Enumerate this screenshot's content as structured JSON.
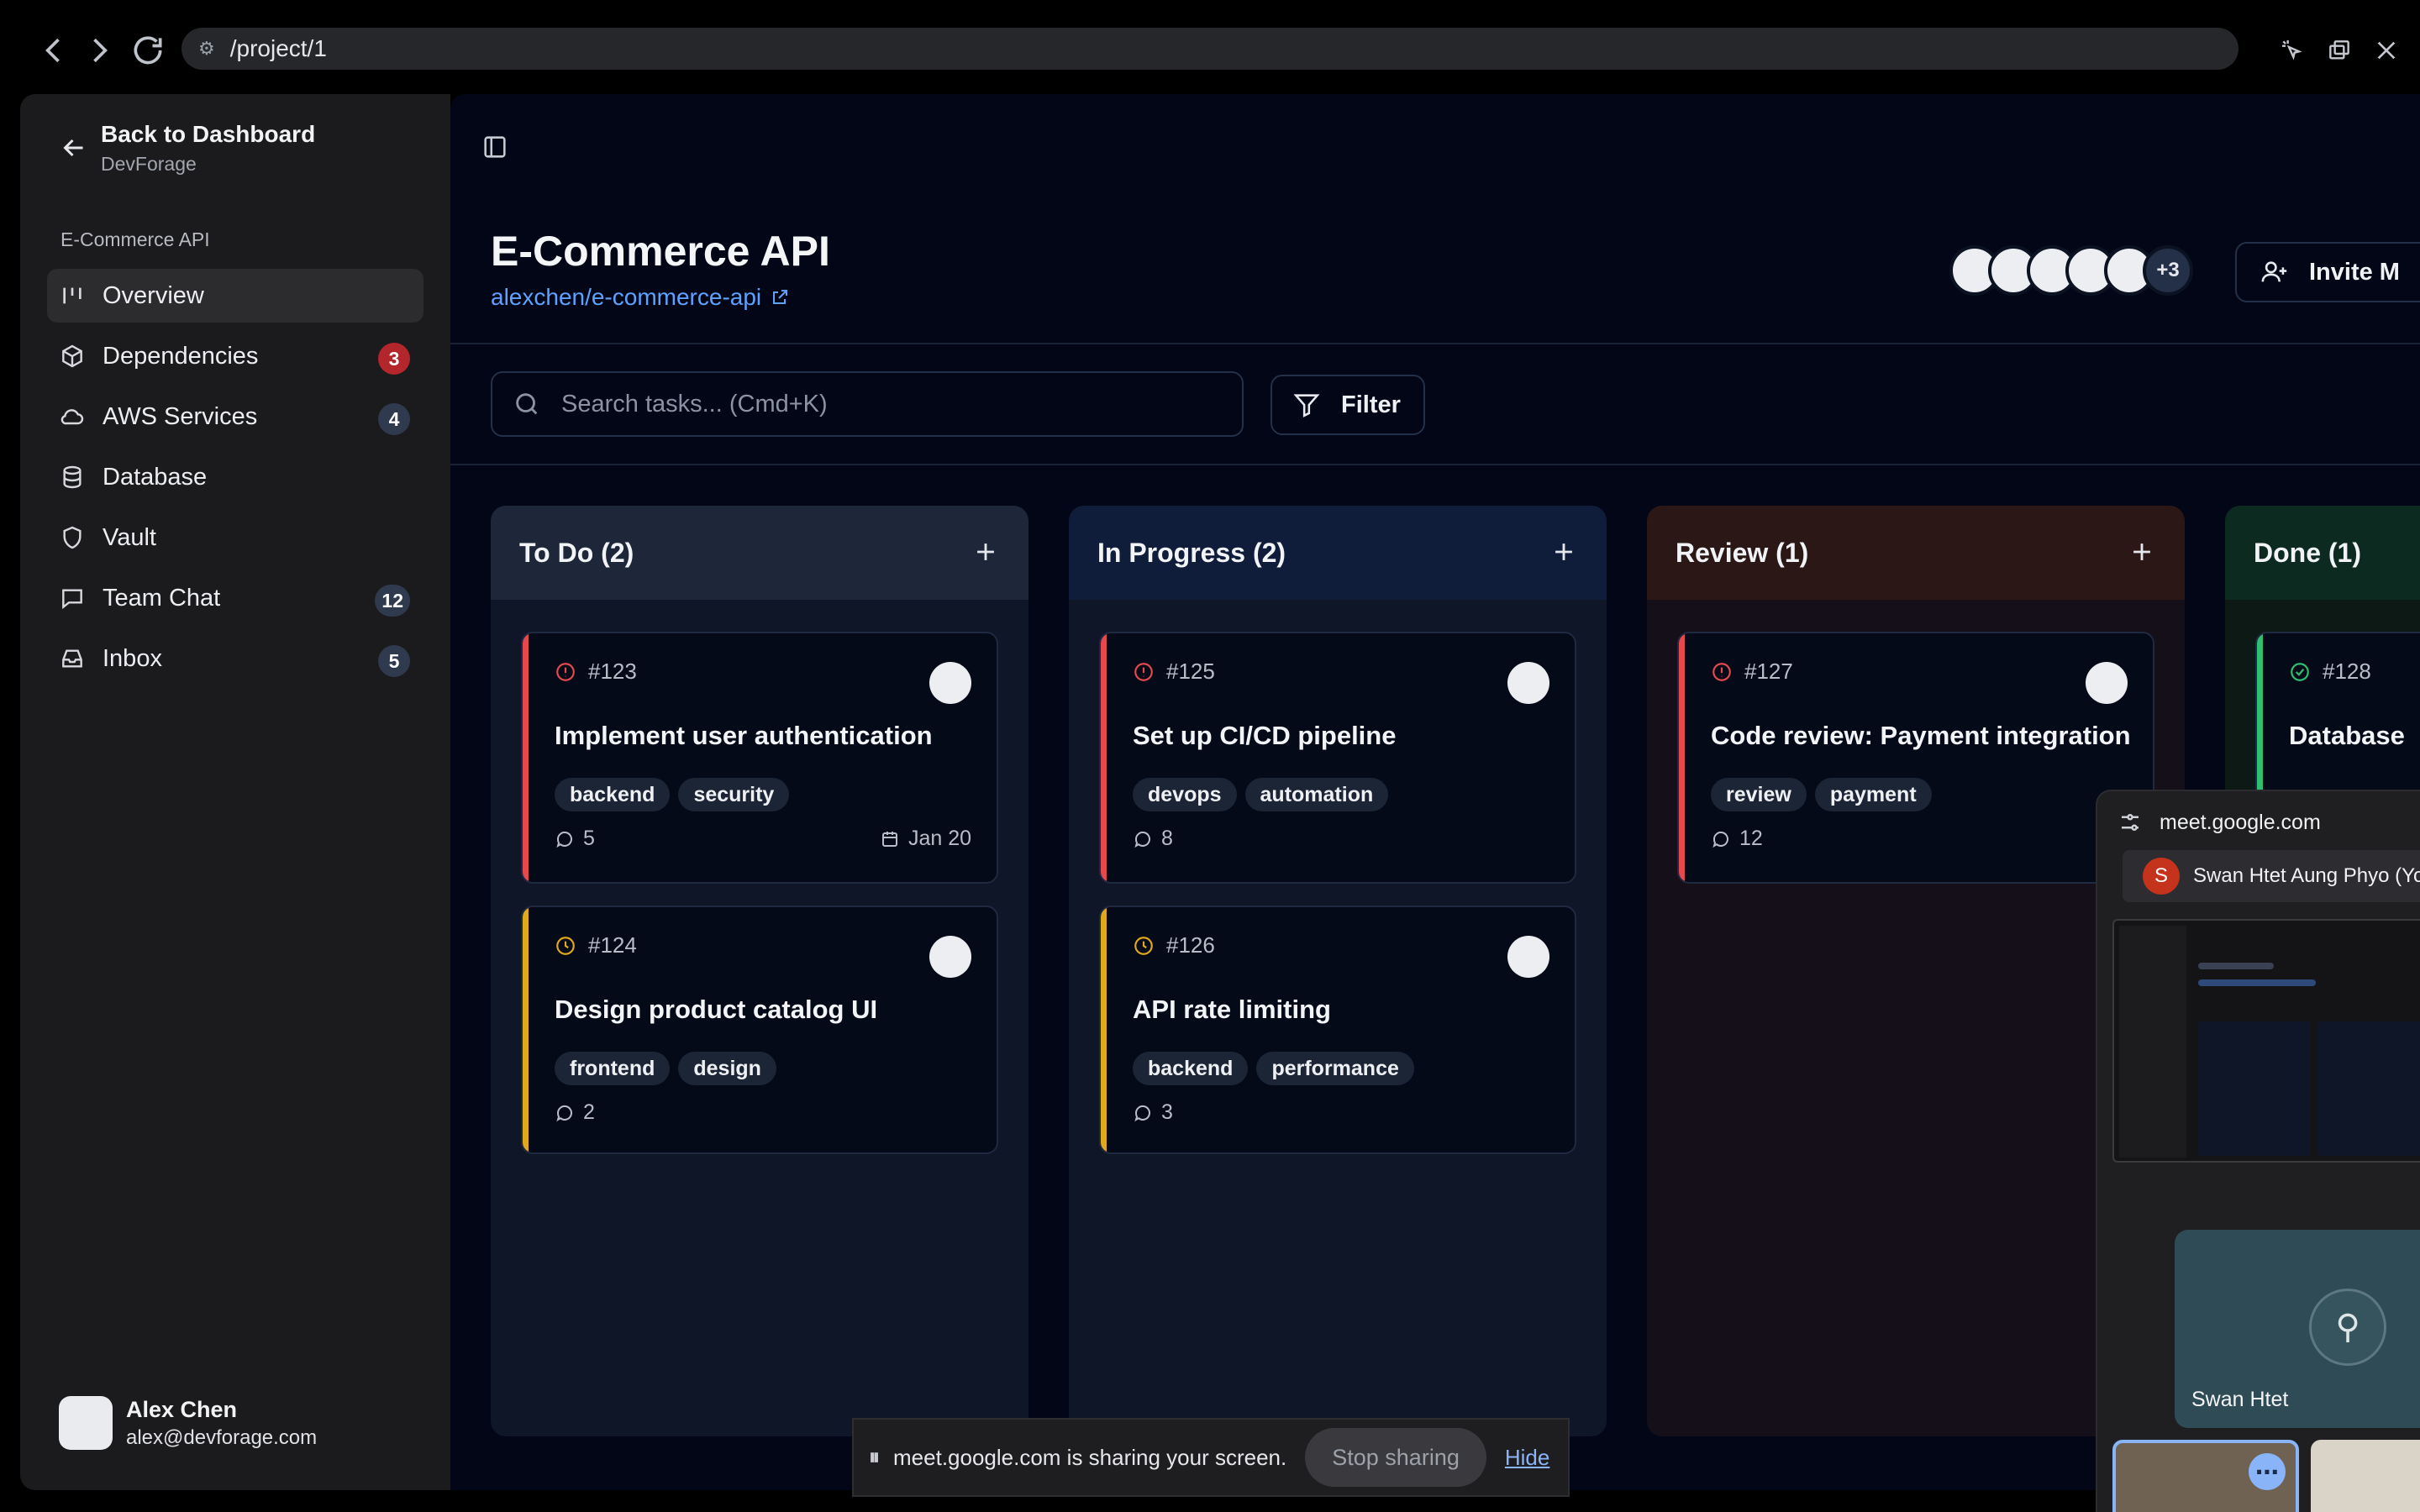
{
  "browser": {
    "url": "/project/1",
    "site_icon": "tune-icon"
  },
  "sidebar": {
    "back_label": "Back to Dashboard",
    "back_sub": "DevForage",
    "project_label": "E-Commerce API",
    "items": [
      {
        "label": "Overview",
        "icon": "kanban-icon",
        "badge": ""
      },
      {
        "label": "Dependencies",
        "icon": "package-icon",
        "badge": "3"
      },
      {
        "label": "AWS Services",
        "icon": "cloud-icon",
        "badge": "4"
      },
      {
        "label": "Database",
        "icon": "database-icon",
        "badge": ""
      },
      {
        "label": "Vault",
        "icon": "shield-icon",
        "badge": ""
      },
      {
        "label": "Team Chat",
        "icon": "chat-icon",
        "badge": "12"
      },
      {
        "label": "Inbox",
        "icon": "inbox-icon",
        "badge": "5"
      }
    ],
    "user": {
      "name": "Alex Chen",
      "email": "alex@devforage.com"
    }
  },
  "header": {
    "title": "E-Commerce API",
    "repo": "alexchen/e-commerce-api",
    "more_members": "+3",
    "invite_label": "Invite M"
  },
  "toolbar": {
    "search_placeholder": "Search tasks... (Cmd+K)",
    "filter_label": "Filter"
  },
  "columns": [
    {
      "title": "To Do (2)",
      "cards": [
        {
          "id": "#123",
          "title": "Implement user authentication",
          "tags": [
            "backend",
            "security"
          ],
          "comments": "5",
          "due": "Jan 20",
          "priority": "high"
        },
        {
          "id": "#124",
          "title": "Design product catalog UI",
          "tags": [
            "frontend",
            "design"
          ],
          "comments": "2",
          "due": "",
          "priority": "medium"
        }
      ]
    },
    {
      "title": "In Progress (2)",
      "cards": [
        {
          "id": "#125",
          "title": "Set up CI/CD pipeline",
          "tags": [
            "devops",
            "automation"
          ],
          "comments": "8",
          "due": "",
          "priority": "high"
        },
        {
          "id": "#126",
          "title": "API rate limiting",
          "tags": [
            "backend",
            "performance"
          ],
          "comments": "3",
          "due": "",
          "priority": "medium"
        }
      ]
    },
    {
      "title": "Review (1)",
      "cards": [
        {
          "id": "#127",
          "title": "Code review: Payment integration",
          "tags": [
            "review",
            "payment"
          ],
          "comments": "12",
          "due": "",
          "priority": "high"
        }
      ]
    },
    {
      "title": "Done (1)",
      "cards": [
        {
          "id": "#128",
          "title": "Database",
          "tags": [],
          "comments": "",
          "due": "",
          "priority": "done"
        }
      ]
    }
  ],
  "meet": {
    "domain": "meet.google.com",
    "participant_initial": "S",
    "participant_name": "Swan Htet Aung Phyo (Yo",
    "tile_name": "Swan Htet"
  },
  "share_bar": {
    "message": "meet.google.com is sharing your screen.",
    "stop_label": "Stop sharing",
    "hide_label": "Hide"
  },
  "colors": {
    "high": "#e5484d",
    "medium": "#e0a91b",
    "done": "#2fbf71",
    "link": "#5ea2ff"
  }
}
